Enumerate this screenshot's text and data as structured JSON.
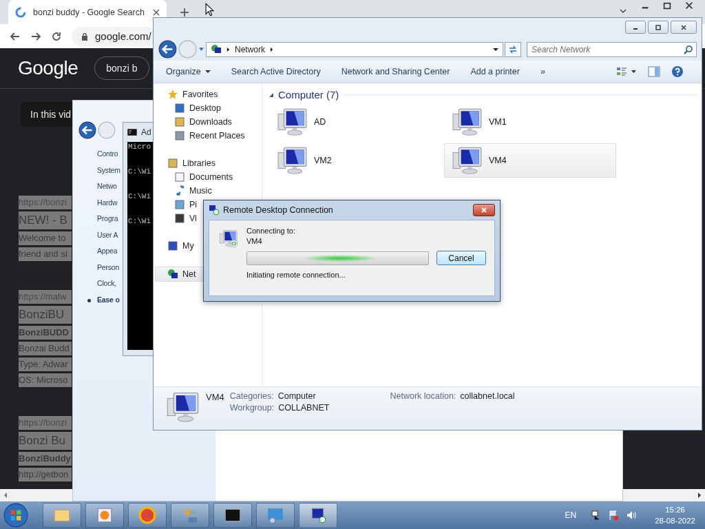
{
  "browser": {
    "tab_title": "bonzi buddy - Google Search",
    "address": "google.com/",
    "logo": "Google",
    "search_query": "bonzi b",
    "video_box": "In this vid",
    "results": [
      {
        "lines": [
          {
            "kind": "url",
            "text": "https://bonzi"
          },
          {
            "kind": "title",
            "text": "NEW! - B"
          },
          {
            "kind": "snippet",
            "text": "Welcome to"
          },
          {
            "kind": "snippet",
            "text": "friend and si"
          }
        ]
      },
      {
        "lines": [
          {
            "kind": "url",
            "text": "https://malw"
          },
          {
            "kind": "title",
            "text": "BonziBU"
          },
          {
            "kind": "bold",
            "text": "BonziBUDD"
          },
          {
            "kind": "snippet",
            "text": "Bonzai Budd"
          },
          {
            "kind": "snippet",
            "text": "Type: Adwar"
          },
          {
            "kind": "snippet",
            "text": "OS: Microso"
          }
        ]
      },
      {
        "lines": [
          {
            "kind": "url",
            "text": "https://bonzi"
          },
          {
            "kind": "title",
            "text": "Bonzi Bu"
          },
          {
            "kind": "bold",
            "text": "BonziBuddy"
          },
          {
            "kind": "snippet",
            "text": "http://getbon"
          }
        ]
      }
    ]
  },
  "control_panel": {
    "items": [
      {
        "text": "Contro",
        "selected": false
      },
      {
        "text": "System",
        "selected": false
      },
      {
        "text": "Netwo",
        "selected": false
      },
      {
        "text": "Hardw",
        "selected": false
      },
      {
        "text": "Progra",
        "selected": false
      },
      {
        "text": "User A",
        "selected": false
      },
      {
        "text": "Appea",
        "selected": false
      },
      {
        "text": "Person",
        "selected": false
      },
      {
        "text": "Clock,",
        "selected": false
      },
      {
        "text": "Ease o",
        "selected": true
      }
    ]
  },
  "cmd": {
    "title": "Ad",
    "lines": [
      "Micro",
      "C:\\Wi",
      "C:\\Wi",
      "C:\\Wi"
    ]
  },
  "explorer": {
    "breadcrumb": "Network",
    "search": {
      "placeholder": "Search Network"
    },
    "toolbar": [
      {
        "label": "Organize",
        "dropdown": true
      },
      {
        "label": "Search Active Directory",
        "dropdown": false
      },
      {
        "label": "Network and Sharing Center",
        "dropdown": false
      },
      {
        "label": "Add a printer",
        "dropdown": false
      }
    ],
    "more": "»",
    "nav": [
      {
        "kind": "star",
        "label": "Favorites",
        "group": true,
        "selected": false
      },
      {
        "kind": "desktop",
        "label": "Desktop",
        "group": false,
        "selected": false
      },
      {
        "kind": "downloads",
        "label": "Downloads",
        "group": false,
        "selected": false
      },
      {
        "kind": "recent",
        "label": "Recent Places",
        "group": false,
        "selected": false
      },
      {
        "kind": "library",
        "label": "Libraries",
        "group": true,
        "selected": false
      },
      {
        "kind": "document",
        "label": "Documents",
        "group": false,
        "selected": false
      },
      {
        "kind": "music",
        "label": "Music",
        "group": false,
        "selected": false
      },
      {
        "kind": "picture",
        "label": "Pi",
        "group": false,
        "selected": false
      },
      {
        "kind": "video",
        "label": "Vi",
        "group": false,
        "selected": false
      },
      {
        "kind": "computer",
        "label": "My",
        "group": true,
        "selected": false
      },
      {
        "kind": "network",
        "label": "Net",
        "group": true,
        "selected": true
      }
    ],
    "group_title": "Computer (7)",
    "computers": [
      {
        "name": "AD",
        "selected": false
      },
      {
        "name": "VM1",
        "selected": false
      },
      {
        "name": "VM2",
        "selected": false
      },
      {
        "name": "VM4",
        "selected": true
      }
    ],
    "details": {
      "name": "VM4",
      "fields": [
        {
          "label": "Categories:",
          "value": "Computer"
        },
        {
          "label": "Workgroup:",
          "value": "COLLABNET"
        }
      ],
      "location": {
        "label": "Network location:",
        "value": "collabnet.local"
      }
    }
  },
  "dialog": {
    "title": "Remote Desktop Connection",
    "connecting_label": "Connecting to:",
    "target": "VM4",
    "status": "Initiating remote connection...",
    "indeterminate": true,
    "button": "Cancel"
  },
  "taskbar": {
    "apps": [
      {
        "kind": "explorer",
        "active": false
      },
      {
        "kind": "media",
        "active": false
      },
      {
        "kind": "chrome",
        "active": false
      },
      {
        "kind": "users",
        "active": false
      },
      {
        "kind": "cmd",
        "active": false
      },
      {
        "kind": "control",
        "active": false
      },
      {
        "kind": "rdp",
        "active": true
      }
    ],
    "language": "EN",
    "time": "15:26",
    "date": "28-08-2022"
  }
}
